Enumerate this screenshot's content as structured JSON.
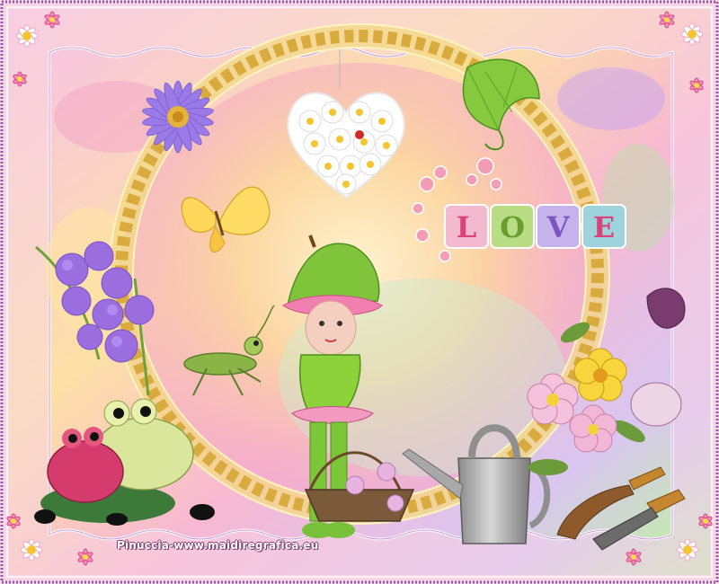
{
  "scene": {
    "love_letters": [
      "L",
      "O",
      "V",
      "E"
    ],
    "watermark": "Pinuccia-www.maidiregrafica.eu"
  },
  "palette": {
    "frame_border": "#8a5aa8",
    "frame_pink": "#f8cfe4",
    "gold": "#e0b84a",
    "leaf_green": "#7fc43a",
    "flower_purple": "#9a7ae6",
    "frog_pink": "#d63b6e",
    "frog_green": "#cfe08a"
  }
}
